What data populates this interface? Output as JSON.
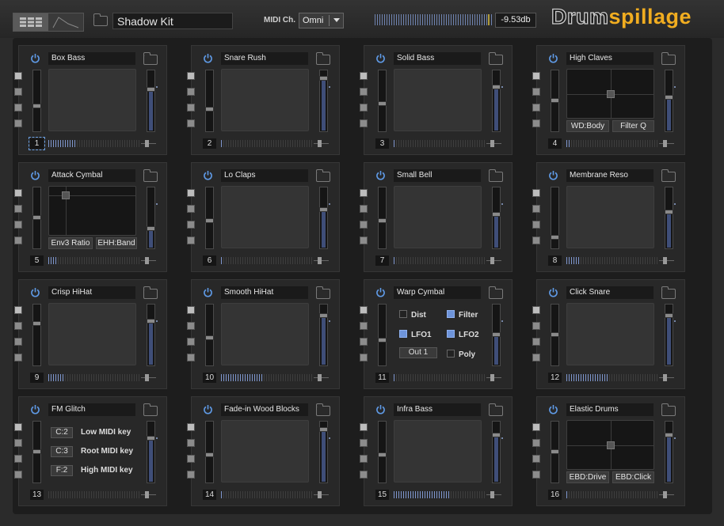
{
  "header": {
    "kit_name": "Shadow Kit",
    "midi_label": "MIDI Ch.",
    "midi_channel": "Omni",
    "gain": "-9.53db",
    "logo_part1": "Drum",
    "logo_part2": "spillage",
    "accent_color": "#f1ad20",
    "view_buttons": [
      "grid-view-icon",
      "envelope-view-icon"
    ]
  },
  "pads": [
    {
      "number": "1",
      "name": "Box Bass",
      "view": "xy",
      "selected": true,
      "level": 0.3,
      "meter": 0.3,
      "pitch": 0.4,
      "volume": 0.7
    },
    {
      "number": "2",
      "name": "Snare Rush",
      "view": "xy",
      "level": 0.0,
      "meter": 0.02,
      "pitch": 0.35,
      "volume": 0.9
    },
    {
      "number": "3",
      "name": "Solid Bass",
      "view": "xy",
      "level": 0.0,
      "meter": 0.02,
      "pitch": 0.45,
      "volume": 0.75
    },
    {
      "number": "4",
      "name": "High Claves",
      "view": "xy-axis",
      "buttons": [
        "WD:Body",
        "Filter Q"
      ],
      "level": 0.05,
      "meter": 0.05,
      "pitch": 0.5,
      "volume": 0.55
    },
    {
      "number": "5",
      "name": "Attack Cymbal",
      "view": "xy-axis",
      "buttons": [
        "Env3 Ratio",
        "EHH:Band"
      ],
      "level": 0.1,
      "meter": 0.1,
      "pitch": 0.5,
      "volume": 0.3
    },
    {
      "number": "6",
      "name": "Lo Claps",
      "view": "xy",
      "level": 0.0,
      "meter": 0.02,
      "pitch": 0.45,
      "volume": 0.65
    },
    {
      "number": "7",
      "name": "Small Bell",
      "view": "xy",
      "level": 0.0,
      "meter": 0.02,
      "pitch": 0.45,
      "volume": 0.55
    },
    {
      "number": "8",
      "name": "Membrane Reso",
      "view": "xy",
      "level": 0.15,
      "meter": 0.15,
      "pitch": 0.15,
      "volume": 0.6
    },
    {
      "number": "9",
      "name": "Crisp HiHat",
      "view": "xy",
      "level": 0.18,
      "meter": 0.18,
      "pitch": 0.7,
      "volume": 0.75
    },
    {
      "number": "10",
      "name": "Smooth HiHat",
      "view": "xy",
      "level": 0.45,
      "meter": 0.45,
      "pitch": 0.45,
      "volume": 0.85
    },
    {
      "number": "11",
      "name": "Warp Cymbal",
      "view": "options",
      "options": [
        {
          "label": "Dist",
          "on": false
        },
        {
          "label": "Filter",
          "on": true
        },
        {
          "label": "LFO1",
          "on": true
        },
        {
          "label": "LFO2",
          "on": true
        },
        {
          "label": "Poly",
          "on": false
        }
      ],
      "out": "Out 1",
      "level": 0.0,
      "meter": 0.02,
      "pitch": 0.4,
      "volume": 0.5
    },
    {
      "number": "12",
      "name": "Click Snare",
      "view": "xy",
      "level": 0.45,
      "meter": 0.45,
      "pitch": 0.5,
      "volume": 0.85
    },
    {
      "number": "13",
      "name": "FM Glitch",
      "view": "keys",
      "keys": [
        {
          "value": "C:2",
          "label": "Low MIDI key"
        },
        {
          "value": "C:3",
          "label": "Root MIDI key"
        },
        {
          "value": "F:2",
          "label": "High MIDI key"
        }
      ],
      "level": 0.0,
      "meter": 0.0,
      "pitch": 0.5,
      "volume": 0.75
    },
    {
      "number": "14",
      "name": "Fade-in Wood Blocks",
      "view": "xy",
      "level": 0.0,
      "meter": 0.02,
      "pitch": 0.45,
      "volume": 0.9
    },
    {
      "number": "15",
      "name": "Infra Bass",
      "view": "xy",
      "level": 0.6,
      "meter": 0.6,
      "pitch": 0.45,
      "volume": 0.8
    },
    {
      "number": "16",
      "name": "Elastic Drums",
      "view": "xy-axis",
      "buttons": [
        "EBD:Drive",
        "EBD:Click"
      ],
      "level": 0.0,
      "meter": 0.02,
      "pitch": 0.5,
      "volume": 0.8
    }
  ]
}
